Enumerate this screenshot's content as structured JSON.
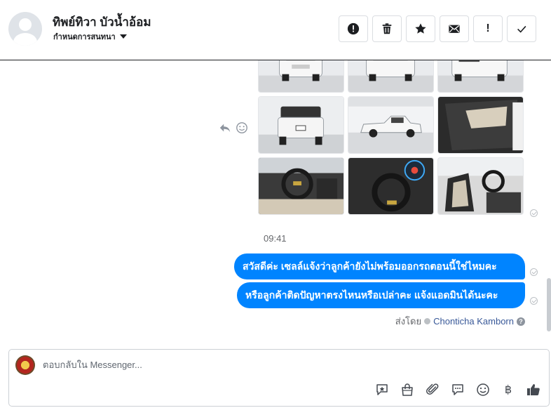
{
  "header": {
    "contact_name": "ทิพย์ทิวา บัวน้ำอ้อม",
    "conversation_settings": "กำหนดการสนทนา",
    "actions": [
      {
        "icon": "alert-circle-icon",
        "name": "mark-spam-button"
      },
      {
        "icon": "trash-icon",
        "name": "delete-button"
      },
      {
        "icon": "star-icon",
        "name": "star-button"
      },
      {
        "icon": "envelope-icon",
        "name": "mark-unread-button"
      },
      {
        "icon": "exclamation-icon",
        "name": "follow-up-button",
        "label": "!"
      },
      {
        "icon": "checkmark-icon",
        "name": "mark-done-button"
      }
    ]
  },
  "thread": {
    "photo_count": 9,
    "time": "09:41",
    "messages": [
      {
        "text": "สวัสดีค่ะ เซลล์แจ้งว่าลูกค้ายังไม่พร้อมออกรถตอนนี้ใช่ไหมคะ",
        "from": "page"
      },
      {
        "text": "หรือลูกค้าติดปัญหาตรงไหนหรือเปล่าคะ แจ้งแอดมินได้นะคะ",
        "from": "page"
      }
    ],
    "sent_by_label": "ส่งโดย",
    "sender_name": "Chonticha Kamborn",
    "help": "?"
  },
  "composer": {
    "placeholder": "ตอบกลับใน Messenger...",
    "tools": [
      "sticker-icon",
      "shopping-bag-icon",
      "paperclip-icon",
      "saved-reply-icon",
      "emoji-icon",
      "baht-icon",
      "thumbs-up-icon"
    ],
    "baht_symbol": "฿"
  },
  "colors": {
    "bubble": "#0084ff",
    "sender_link": "#385898",
    "muted": "#65676b"
  }
}
